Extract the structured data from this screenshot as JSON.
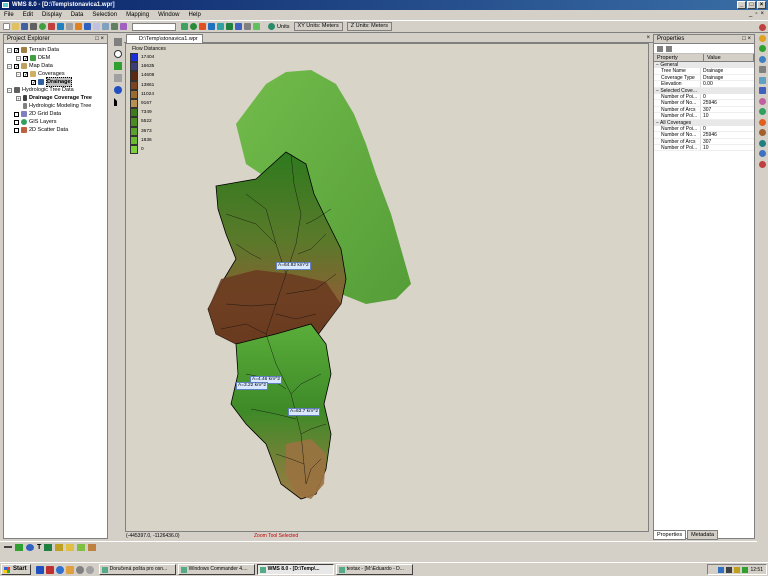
{
  "window": {
    "title": "WMS 8.0 - [D:\\Temp\\stonavica1.wpr]"
  },
  "menu": [
    "File",
    "Edit",
    "Display",
    "Data",
    "Selection",
    "Mapping",
    "Window",
    "Help"
  ],
  "toolbar": {
    "units_label": "Units",
    "xy_units": "XY Units: Meters",
    "z_units": "Z Units: Meters"
  },
  "explorer": {
    "title": "Project Explorer",
    "items": [
      {
        "label": "Terrain Data"
      },
      {
        "label": "DEM"
      },
      {
        "label": "Map Data"
      },
      {
        "label": "Coverages"
      },
      {
        "label": "Drainage"
      },
      {
        "label": "Hydrologic Tree Data"
      },
      {
        "label": "Drainage Coverage Tree"
      },
      {
        "label": "Hydrologic Modeling Tree"
      },
      {
        "label": "2D Grid Data"
      },
      {
        "label": "GIS Layers"
      },
      {
        "label": "2D Scatter Data"
      }
    ]
  },
  "document": {
    "tab": "D:\\Temp\\stonavica1.wpr"
  },
  "legend": {
    "title": "Flow Distances",
    "entries": [
      {
        "value": "17404",
        "color": "#1a2ee0"
      },
      {
        "value": "16635",
        "color": "#3c3c78"
      },
      {
        "value": "14608",
        "color": "#5a2a14"
      },
      {
        "value": "13861",
        "color": "#7a4420"
      },
      {
        "value": "11024",
        "color": "#9a6a30"
      },
      {
        "value": "9167",
        "color": "#b89050"
      },
      {
        "value": "7349",
        "color": "#3e7a1e"
      },
      {
        "value": "5522",
        "color": "#4c8a22"
      },
      {
        "value": "3673",
        "color": "#5aa02a"
      },
      {
        "value": "1836",
        "color": "#6cb832"
      },
      {
        "value": "0",
        "color": "#7cd03a"
      }
    ]
  },
  "areas": [
    {
      "label": "A=64.82 km^2"
    },
    {
      "label": "A=4.46 km^2"
    },
    {
      "label": "A=3.22 km^2"
    },
    {
      "label": "A=63.7 km^2"
    }
  ],
  "status": {
    "coords": "(-445397.0, -1126436.0)",
    "tool": "Zoom Tool Selected"
  },
  "properties": {
    "title": "Properties",
    "col_property": "Property",
    "col_value": "Value",
    "groups": [
      {
        "name": "General",
        "rows": [
          {
            "k": "Tree Name",
            "v": "Drainage"
          },
          {
            "k": "Coverage Type",
            "v": "Drainage"
          },
          {
            "k": "Elevation",
            "v": "0.00"
          }
        ]
      },
      {
        "name": "Selected Cove...",
        "rows": [
          {
            "k": "Number of Poi...",
            "v": "0"
          },
          {
            "k": "Number of No...",
            "v": "25946"
          },
          {
            "k": "Number of Arcs",
            "v": "307"
          },
          {
            "k": "Number of Pol...",
            "v": "10"
          }
        ]
      },
      {
        "name": "All Coverages",
        "rows": [
          {
            "k": "Number of Poi...",
            "v": "0"
          },
          {
            "k": "Number of No...",
            "v": "25946"
          },
          {
            "k": "Number of Arcs",
            "v": "307"
          },
          {
            "k": "Number of Pol...",
            "v": "10"
          }
        ]
      }
    ],
    "tabs": [
      "Properties",
      "Metadata"
    ]
  },
  "taskbar": {
    "start": "Start",
    "tasks": [
      "Doručená pošta pro osn...",
      "Windows Commander 4....",
      "WMS 8.0 - [D:\\Temp\\...",
      "textax - [M:\\Eduardo - D..."
    ],
    "clock": "12:51"
  }
}
